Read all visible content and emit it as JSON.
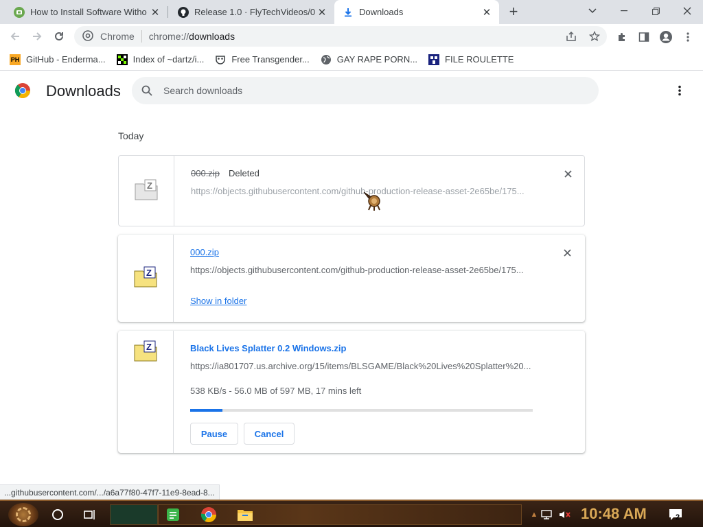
{
  "tabs": [
    {
      "title": "How to Install Software Witho",
      "icon": "puzzle-app-icon",
      "active": false
    },
    {
      "title": "Release 1.0 · FlyTechVideos/00",
      "icon": "github-icon",
      "active": false
    },
    {
      "title": "Downloads",
      "icon": "download-icon",
      "active": true
    }
  ],
  "omnibox": {
    "chip_label": "Chrome",
    "url_scheme": "chrome://",
    "url_path": "downloads"
  },
  "bookmarks": [
    {
      "label": "GitHub - Enderma...",
      "icon": "ph-icon",
      "icon_text": "PH"
    },
    {
      "label": "Index of ~dartz/i...",
      "icon": "pixel-icon",
      "icon_text": ""
    },
    {
      "label": "Free Transgender...",
      "icon": "mask-icon",
      "icon_text": ""
    },
    {
      "label": "GAY RAPE PORN...",
      "icon": "globe-icon",
      "icon_text": ""
    },
    {
      "label": "FILE ROULETTE",
      "icon": "file-roulette-icon",
      "icon_text": ""
    }
  ],
  "page": {
    "title": "Downloads",
    "search_placeholder": "Search downloads",
    "section": "Today"
  },
  "downloads": [
    {
      "filename": "000.zip",
      "status": "Deleted",
      "url": "https://objects.githubusercontent.com/github-production-release-asset-2e65be/175...",
      "state": "deleted"
    },
    {
      "filename": "000.zip",
      "url": "https://objects.githubusercontent.com/github-production-release-asset-2e65be/175...",
      "action": "Show in folder",
      "state": "complete"
    },
    {
      "filename": "Black Lives Splatter 0.2 Windows.zip",
      "url": "https://ia801707.us.archive.org/15/items/BLSGAME/Black%20Lives%20Splatter%20...",
      "progress_text": "538 KB/s - 56.0 MB of 597 MB, 17 mins left",
      "progress_fraction": 0.094,
      "pause_label": "Pause",
      "cancel_label": "Cancel",
      "state": "in_progress"
    }
  ],
  "status_bubble": "...githubusercontent.com/.../a6a77f80-47f7-11e9-8ead-8...",
  "taskbar": {
    "clock": "10:48 AM",
    "notification_count": "2"
  },
  "colors": {
    "accent": "#1a73e8",
    "tabstrip": "#dee1e6",
    "taskbar": "#2a170a",
    "clock": "#d9a856"
  }
}
